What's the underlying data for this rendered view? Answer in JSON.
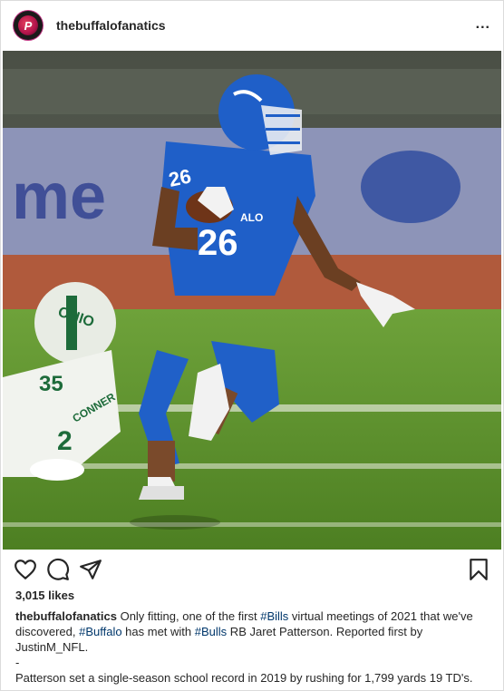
{
  "header": {
    "username": "thebuffalofanatics",
    "avatar_letter": "P",
    "more_label": "..."
  },
  "photo": {
    "players": {
      "runner_number": "26",
      "runner_chest": "ALO",
      "defender_helmet": "OHIO",
      "defender_number": "35",
      "defender_back_number": "2",
      "defender_name": "CONNER"
    },
    "banner_text": "me",
    "icons": [
      "heart-icon",
      "comment-icon",
      "share-icon",
      "bookmark-icon"
    ]
  },
  "engagement": {
    "likes": "3,015 likes"
  },
  "caption": {
    "username": "thebuffalofanatics",
    "p1_a": " Only fitting, one of the first ",
    "tag1": "#Bills",
    "p1_b": " virtual meetings of 2021 that we've discovered, ",
    "tag2": "#Buffalo",
    "p1_c": " has met with ",
    "tag3": "#Bulls",
    "p1_d": " RB Jaret Patterson. Reported first by JustinM_NFL.",
    "dash": "-",
    "p2": "Patterson set a single-season school record in 2019 by rushing for 1,799 yards 19 TD's.",
    "p3": "—"
  },
  "colors": {
    "jersey_blue": "#1f5fc8",
    "turf_green": "#5a8f2a",
    "hashtag": "#00376b"
  }
}
